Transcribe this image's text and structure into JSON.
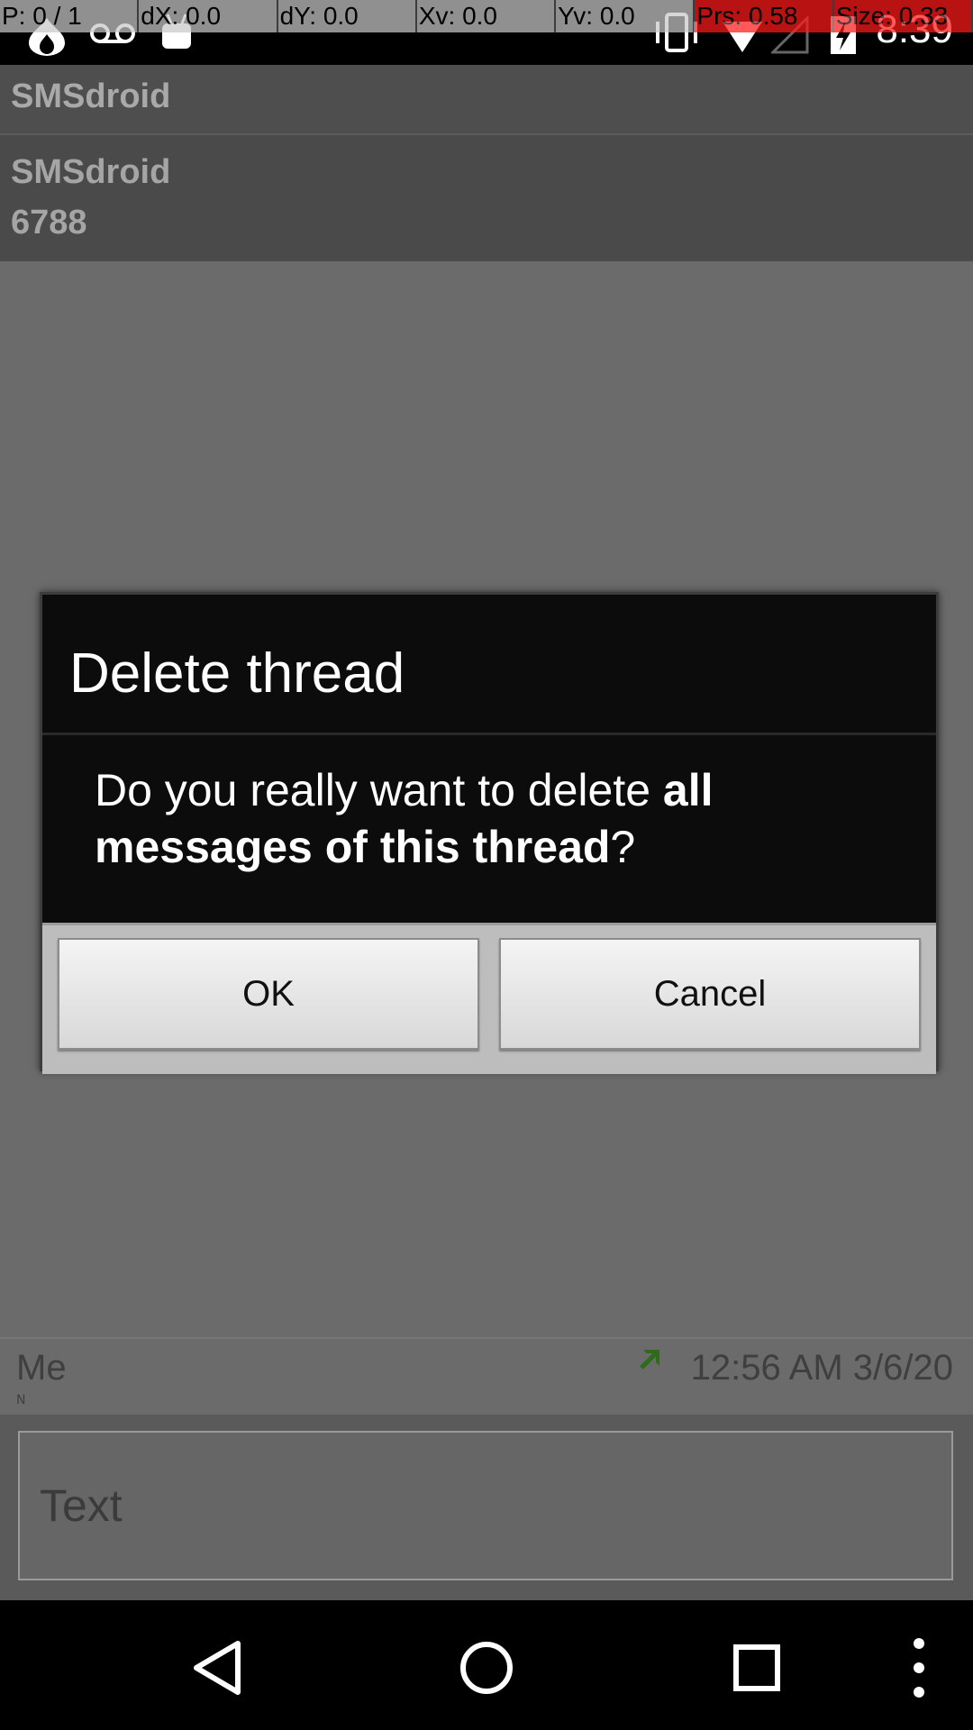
{
  "status_bar": {
    "time": "8:39",
    "icons": [
      "notification-flame-icon",
      "voicemail-icon",
      "android-icon",
      "vibrate-icon",
      "wifi-icon",
      "cell-signal-icon",
      "battery-charging-icon"
    ]
  },
  "pointer_overlay": {
    "p": "P: 0 / 1",
    "dx": "dX: 0.0",
    "dy": "dY: 0.0",
    "xv": "Xv: 0.0",
    "yv": "Yv: 0.0",
    "prs": "Prs: 0.58",
    "size": "Size: 0.33"
  },
  "app_bar": {
    "title": "SMSdroid"
  },
  "thread_header": {
    "name": "SMSdroid",
    "number": "6788"
  },
  "dialog": {
    "title": "Delete thread",
    "message_prefix": "Do you really want to delete ",
    "message_bold": "all messages of this thread",
    "message_suffix": "?",
    "ok_label": "OK",
    "cancel_label": "Cancel"
  },
  "message": {
    "sender": "Me",
    "sub": "N",
    "timestamp": "12:56 AM 3/6/20"
  },
  "compose": {
    "placeholder": "Text",
    "value": ""
  },
  "colors": {
    "dim_background": "#6b6b6b",
    "dialog_background": "#0c0c0c",
    "button_bar": "#bdbdbd",
    "pointer_hot": "#ff1a1a"
  }
}
